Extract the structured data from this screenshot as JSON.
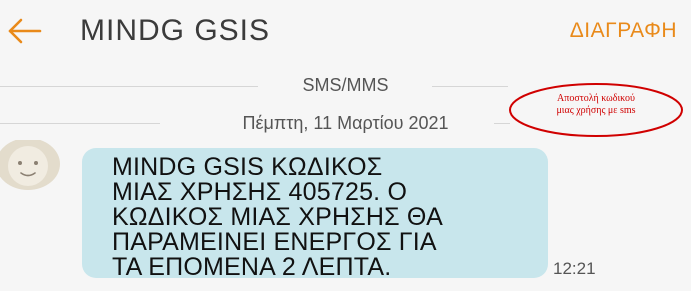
{
  "header": {
    "back_icon": "arrow-left-icon",
    "title": "MINDG GSIS",
    "delete_label": "ΔΙΑΓΡΑΦΗ",
    "accent_color": "#e98a1a"
  },
  "conversation": {
    "channel_label": "SMS/MMS",
    "date_label": "Πέμπτη, 11 Μαρτίου 2021"
  },
  "annotation": {
    "line1": "Αποστολή κωδικού",
    "line2": "μιας χρήσης με sms",
    "color": "#d00000"
  },
  "message": {
    "avatar_icon": "contact-avatar-icon",
    "text": "MINDG GSIS ΚΩΔΙΚΟΣ\nΜΙΑΣ ΧΡΗΣΗΣ 405725. Ο\nΚΩΔΙΚΟΣ ΜΙΑΣ ΧΡΗΣΗΣ ΘΑ\nΠΑΡΑΜΕΙΝΕΙ ΕΝΕΡΓΟΣ ΓΙΑ\nΤΑ ΕΠΟΜΕΝΑ 2 ΛΕΠΤΑ.",
    "time": "12:21",
    "bubble_color": "#c8e6ec"
  }
}
